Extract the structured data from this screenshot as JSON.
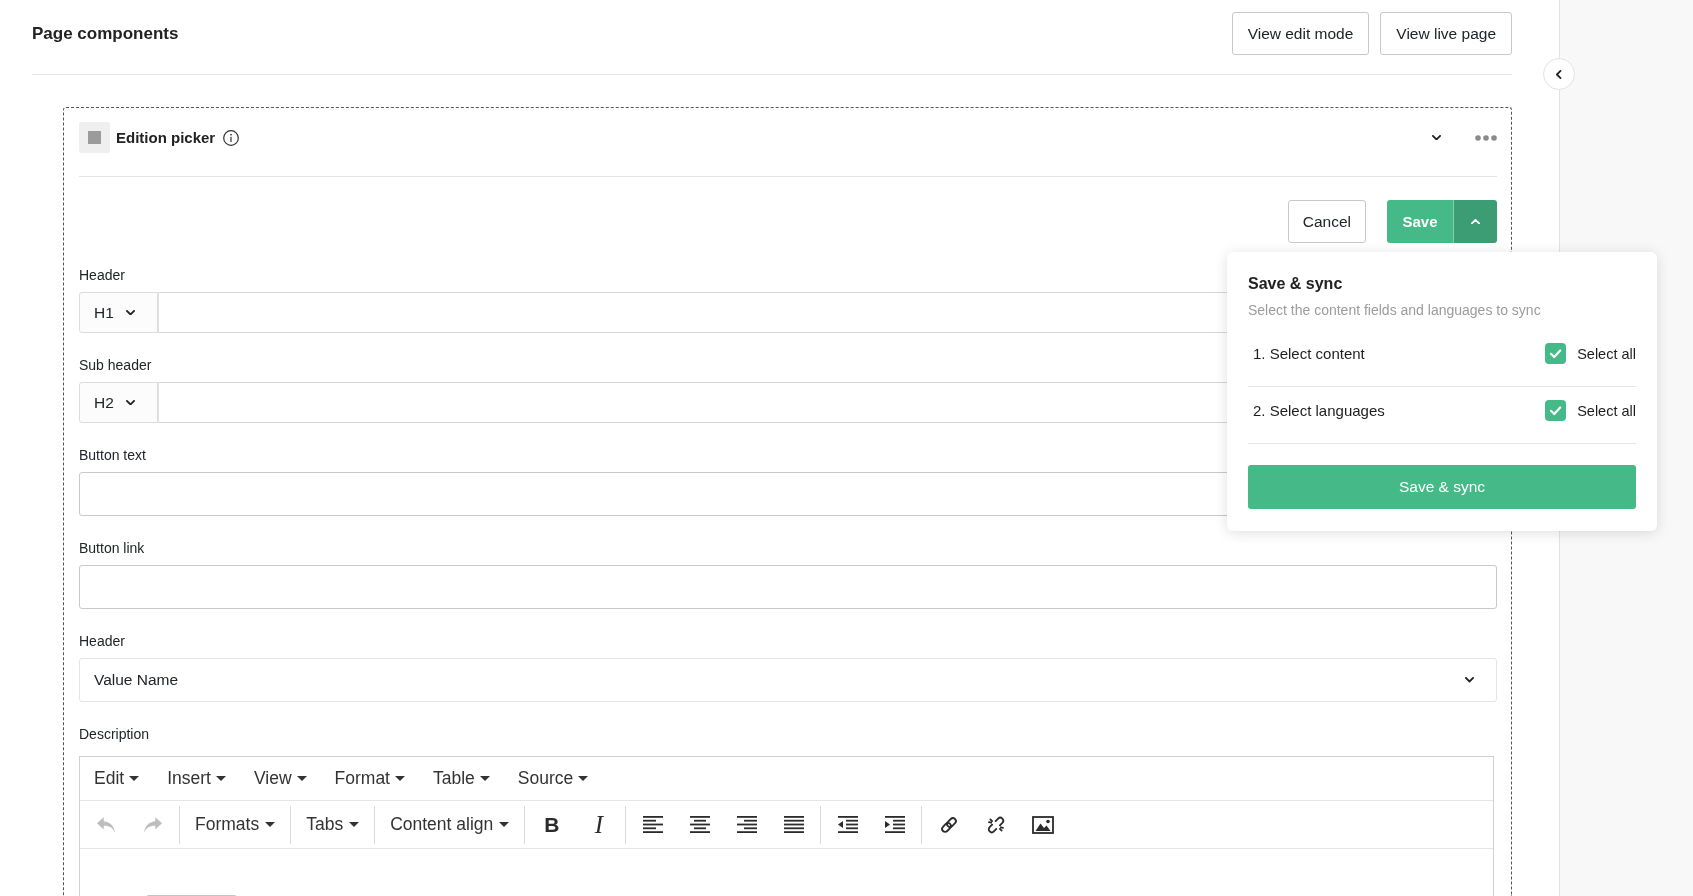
{
  "page": {
    "title": "Page components",
    "buttons": [
      "View edit mode",
      "View live page"
    ]
  },
  "component": {
    "title": "Edition picker",
    "cancel": "Cancel",
    "save": "Save",
    "save_menu": {
      "expanded": true,
      "title": "Save & sync",
      "subtitle": "Select the content fields and languages to sync",
      "steps": [
        {
          "label": "1. Select content",
          "option": "Select all",
          "checked": true
        },
        {
          "label": "2. Select languages",
          "option": "Select all",
          "checked": true
        }
      ],
      "submit": "Save & sync"
    },
    "fields": [
      {
        "kind": "heading",
        "label": "Header",
        "tag": "H1"
      },
      {
        "kind": "heading",
        "label": "Sub header",
        "tag": "H2"
      },
      {
        "kind": "text",
        "label": "Button text"
      },
      {
        "kind": "text",
        "label": "Button link"
      },
      {
        "kind": "select",
        "label": "Header",
        "value": "Value Name"
      },
      {
        "kind": "editor",
        "label": "Description",
        "menu": [
          "Edit",
          "Insert",
          "View",
          "Format",
          "Table",
          "Source"
        ],
        "toolbar": {
          "undo": {
            "disabled": true
          },
          "redo": {
            "disabled": true
          },
          "dropdowns": [
            "Formats",
            "Tabs",
            "Content align"
          ],
          "styles": [
            "B",
            "I"
          ]
        }
      }
    ]
  }
}
